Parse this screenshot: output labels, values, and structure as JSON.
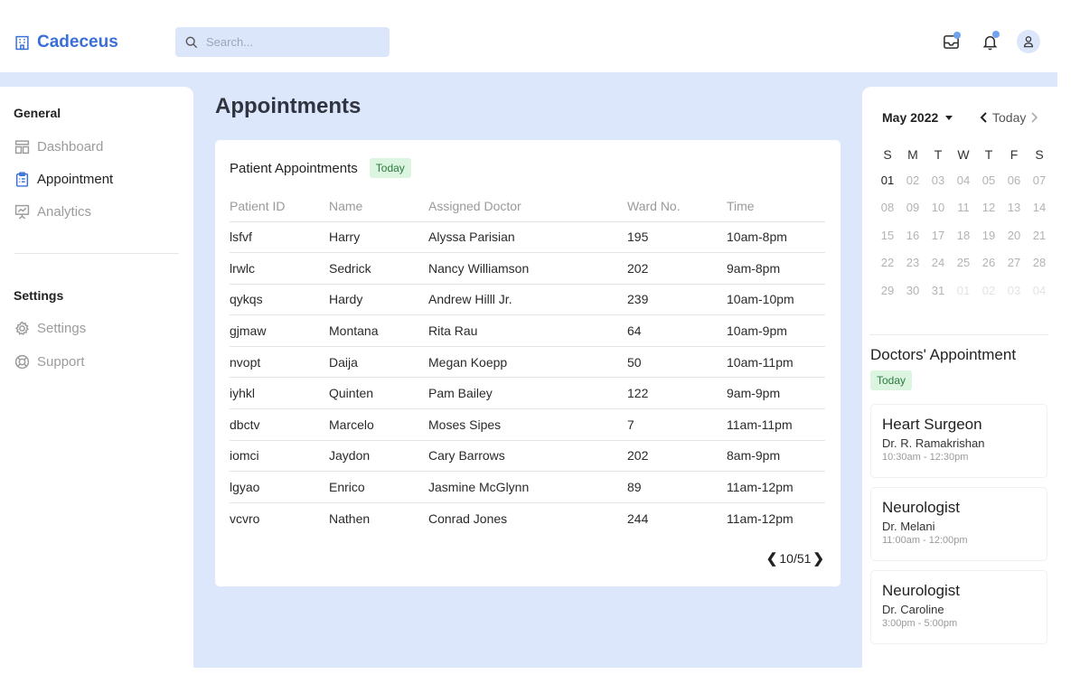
{
  "app": {
    "name": "Cadeceus"
  },
  "search": {
    "placeholder": "Search..."
  },
  "sidebar": {
    "general_title": "General",
    "general_items": [
      {
        "label": "Dashboard",
        "icon": "dashboard-icon"
      },
      {
        "label": "Appointment",
        "icon": "clipboard-icon",
        "active": true
      },
      {
        "label": "Analytics",
        "icon": "presentation-chart-icon"
      }
    ],
    "settings_title": "Settings",
    "settings_items": [
      {
        "label": "Settings",
        "icon": "gear-icon"
      },
      {
        "label": "Support",
        "icon": "lifebuoy-icon"
      }
    ]
  },
  "main": {
    "title": "Appointments",
    "card": {
      "title": "Patient Appointments",
      "badge": "Today",
      "columns": [
        "Patient ID",
        "Name",
        "Assigned Doctor",
        "Ward No.",
        "Time"
      ],
      "rows": [
        [
          "lsfvf",
          "Harry",
          "Alyssa Parisian",
          "195",
          "10am-8pm"
        ],
        [
          "lrwlc",
          "Sedrick",
          "Nancy Williamson",
          "202",
          "9am-8pm"
        ],
        [
          "qykqs",
          "Hardy",
          "Andrew Hilll Jr.",
          "239",
          "10am-10pm"
        ],
        [
          "gjmaw",
          "Montana",
          "Rita Rau",
          "64",
          "10am-9pm"
        ],
        [
          "nvopt",
          "Daija",
          "Megan Koepp",
          "50",
          "10am-11pm"
        ],
        [
          "iyhkl",
          "Quinten",
          "Pam Bailey",
          "122",
          "9am-9pm"
        ],
        [
          "dbctv",
          "Marcelo",
          "Moses Sipes",
          "7",
          "11am-11pm"
        ],
        [
          "iomci",
          "Jaydon",
          "Cary Barrows",
          "202",
          "8am-9pm"
        ],
        [
          "lgyao",
          "Enrico",
          "Jasmine McGlynn",
          "89",
          "11am-12pm"
        ],
        [
          "vcvro",
          "Nathen",
          "Conrad Jones",
          "244",
          "11am-12pm"
        ]
      ],
      "pagination": "10/51"
    }
  },
  "calendar": {
    "month_label": "May 2022",
    "today_label": "Today",
    "weekdays": [
      "S",
      "M",
      "T",
      "W",
      "T",
      "F",
      "S"
    ],
    "days": [
      "01",
      "02",
      "03",
      "04",
      "05",
      "06",
      "07",
      "08",
      "09",
      "10",
      "11",
      "12",
      "13",
      "14",
      "15",
      "16",
      "17",
      "18",
      "19",
      "20",
      "21",
      "22",
      "23",
      "24",
      "25",
      "26",
      "27",
      "28",
      "29",
      "30",
      "31",
      "01",
      "02",
      "03",
      "04"
    ],
    "today_index": 0,
    "out_of_month_from_index": 31
  },
  "doctors": {
    "title": "Doctors' Appointment",
    "badge": "Today",
    "items": [
      {
        "specialty": "Heart Surgeon",
        "name": "Dr. R. Ramakrishan",
        "time": "10:30am - 12:30pm"
      },
      {
        "specialty": "Neurologist",
        "name": "Dr. Melani",
        "time": "11:00am - 12:00pm"
      },
      {
        "specialty": "Neurologist",
        "name": "Dr. Caroline",
        "time": "3:00pm - 5:00pm"
      }
    ]
  },
  "colors": {
    "accent": "#3a6fd8",
    "background": "#dce7fb",
    "badge_bg": "#dcf5e1",
    "badge_text": "#2b7a3d"
  }
}
